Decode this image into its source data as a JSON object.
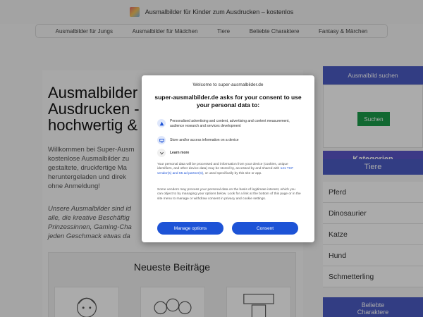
{
  "header": {
    "site_title": "Ausmalbilder für Kinder zum Ausdrucken – kostenlos"
  },
  "nav": {
    "items": [
      "Ausmalbilder für Jungs",
      "Ausmalbilder für Mädchen",
      "Tiere",
      "Beliebte Charaktere",
      "Fantasy & Märchen"
    ]
  },
  "main": {
    "headline_lines": [
      "Ausmalbilder",
      "Ausdrucken -",
      "hochwertig &"
    ],
    "intro_lines": [
      "Willkommen bei Super-Ausm",
      "kostenlose Ausmalbilder zu",
      "gestaltete, druckfertige Ma",
      "heruntergeladen und direk",
      "ohne Anmeldung!"
    ],
    "italic_lines": [
      "Unsere Ausmalbilder sind id",
      "alle, die kreative Beschäftig",
      "Prinzessinnen, Gaming-Cha",
      "jeden Geschmack etwas da"
    ],
    "recent_title": "Neueste Beiträge"
  },
  "sidebar": {
    "search_heading": "Ausmalbild suchen",
    "search_button": "Suchen",
    "kategorien": "Kategorien",
    "tiere": "Tiere",
    "animals": [
      "Pferd",
      "Dinosaurier",
      "Katze",
      "Hund",
      "Schmetterling"
    ],
    "beliebte": "Beliebte\nCharaktere"
  },
  "dialog": {
    "welcome": "Welcome to super-ausmalbilder.de",
    "heading": "super-ausmalbilder.de asks for your consent to use your personal data to:",
    "purposes": [
      "Personalised advertising and content, advertising and content measurement, audience research and services development",
      "Store and/or access information on a device",
      "Learn more"
    ],
    "para1_a": "Your personal data will be processed and information from your device (cookies, unique identifiers, and other device data) may be stored by, accessed by and shared with ",
    "para1_link": "141 TCF vendor(s) and 65 ad partner(s)",
    "para1_b": ", or used specifically by this site or app.",
    "para2": "Some vendors may process your personal data on the basis of legitimate interest, which you can object to by managing your options below. Look for a link at the bottom of this page or in the site menu to manage or withdraw consent in privacy and cookie settings.",
    "manage_label": "Manage options",
    "consent_label": "Consent"
  },
  "colors": {
    "accent_blue": "#1d53d6",
    "sidebar_blue": "#4b5bc4",
    "search_green": "#1a9c4a"
  },
  "icons": [
    "logo-icon",
    "personalised-ads-icon",
    "device-storage-icon",
    "learn-more-chevron-icon"
  ]
}
